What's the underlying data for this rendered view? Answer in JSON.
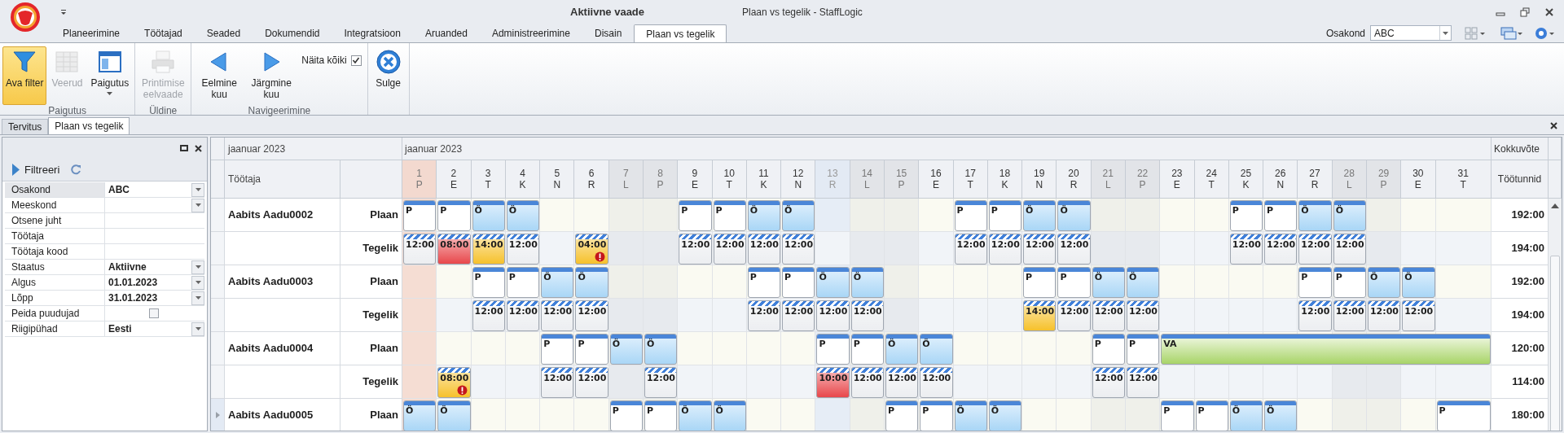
{
  "window": {
    "view_label": "Aktiivne vaade",
    "title": "Plaan vs tegelik - StaffLogic"
  },
  "ribbon_tabs": [
    {
      "label": "Planeerimine",
      "selected": false
    },
    {
      "label": "Töötajad",
      "selected": false
    },
    {
      "label": "Seaded",
      "selected": false
    },
    {
      "label": "Dokumendid",
      "selected": false
    },
    {
      "label": "Integratsioon",
      "selected": false
    },
    {
      "label": "Aruanded",
      "selected": false
    },
    {
      "label": "Administreerimine",
      "selected": false
    },
    {
      "label": "Disain",
      "selected": false
    },
    {
      "label": "Plaan vs tegelik",
      "selected": true
    }
  ],
  "department": {
    "label": "Osakond",
    "value": "ABC"
  },
  "ribbon_groups": [
    {
      "label": "Paigutus",
      "items": [
        {
          "kind": "filter",
          "label": "Ava filter",
          "pressed": true,
          "disabled": false,
          "dropdown": false
        },
        {
          "kind": "columns",
          "label": "Veerud",
          "pressed": false,
          "disabled": true,
          "dropdown": false
        },
        {
          "kind": "layout",
          "label": "Paigutus",
          "pressed": false,
          "disabled": false,
          "dropdown": true
        }
      ]
    },
    {
      "label": "Üldine",
      "items": [
        {
          "kind": "print",
          "label": "Printimise eelvaade",
          "pressed": false,
          "disabled": true,
          "dropdown": false
        }
      ]
    },
    {
      "label": "Navigeerimine",
      "items": [
        {
          "kind": "previous",
          "label": "Eelmine kuu",
          "pressed": false,
          "disabled": false,
          "dropdown": false
        },
        {
          "kind": "next",
          "label": "Järgmine kuu",
          "pressed": false,
          "disabled": false,
          "dropdown": false
        },
        {
          "kind": "checkbox",
          "label": "Näita kõiki",
          "checked": true
        }
      ]
    },
    {
      "items": [
        {
          "kind": "close",
          "label": "Sulge",
          "pressed": false,
          "disabled": false,
          "dropdown": false
        }
      ]
    }
  ],
  "document_tabs": [
    {
      "label": "Tervitus",
      "selected": false
    },
    {
      "label": "Plaan vs tegelik",
      "selected": true
    }
  ],
  "filter_panel": {
    "button": "Filtreeri",
    "fields": [
      {
        "label": "Osakond",
        "value": "ABC",
        "kind": "dropdown",
        "selected": true
      },
      {
        "label": "Meeskond",
        "kind": "dropdown",
        "selected": false
      },
      {
        "label": "Otsene juht",
        "kind": "text",
        "selected": false
      },
      {
        "label": "Töötaja",
        "kind": "text",
        "selected": false
      },
      {
        "label": "Töötaja kood",
        "kind": "text",
        "selected": false
      },
      {
        "label": "Staatus",
        "value": "Aktiivne",
        "kind": "dropdown",
        "selected": false
      },
      {
        "label": "Algus",
        "value": "01.01.2023",
        "kind": "dropdown",
        "selected": false
      },
      {
        "label": "Lõpp",
        "value": "31.01.2023",
        "kind": "dropdown",
        "selected": false
      },
      {
        "label": "Peida puudujad",
        "kind": "checkbox",
        "checked": false,
        "selected": false
      },
      {
        "label": "Riigipühad",
        "value": "Eesti",
        "kind": "dropdown",
        "selected": false
      }
    ]
  },
  "schedule": {
    "left_month": "jaanuar 2023",
    "month": "jaanuar 2023",
    "employee_header": "Töötaja",
    "summary_header": "Kokkuvõte",
    "hours_header": "Töötunnid",
    "days": [
      {
        "date": "1",
        "weekday": "P",
        "kind": "holiday"
      },
      {
        "date": "2",
        "weekday": "E",
        "kind": "weekday"
      },
      {
        "date": "3",
        "weekday": "T",
        "kind": "weekday"
      },
      {
        "date": "4",
        "weekday": "K",
        "kind": "weekday"
      },
      {
        "date": "5",
        "weekday": "N",
        "kind": "weekday"
      },
      {
        "date": "6",
        "weekday": "R",
        "kind": "weekday"
      },
      {
        "date": "7",
        "weekday": "L",
        "kind": "weekend"
      },
      {
        "date": "8",
        "weekday": "P",
        "kind": "weekend"
      },
      {
        "date": "9",
        "weekday": "E",
        "kind": "weekday"
      },
      {
        "date": "10",
        "weekday": "T",
        "kind": "weekday"
      },
      {
        "date": "11",
        "weekday": "K",
        "kind": "weekday"
      },
      {
        "date": "12",
        "weekday": "N",
        "kind": "weekday"
      },
      {
        "date": "13",
        "weekday": "R",
        "kind": "today"
      },
      {
        "date": "14",
        "weekday": "L",
        "kind": "weekend"
      },
      {
        "date": "15",
        "weekday": "P",
        "kind": "weekend"
      },
      {
        "date": "16",
        "weekday": "E",
        "kind": "weekday"
      },
      {
        "date": "17",
        "weekday": "T",
        "kind": "weekday"
      },
      {
        "date": "18",
        "weekday": "K",
        "kind": "weekday"
      },
      {
        "date": "19",
        "weekday": "N",
        "kind": "weekday"
      },
      {
        "date": "20",
        "weekday": "R",
        "kind": "weekday"
      },
      {
        "date": "21",
        "weekday": "L",
        "kind": "weekend"
      },
      {
        "date": "22",
        "weekday": "P",
        "kind": "weekend"
      },
      {
        "date": "23",
        "weekday": "E",
        "kind": "weekday"
      },
      {
        "date": "24",
        "weekday": "T",
        "kind": "weekday"
      },
      {
        "date": "25",
        "weekday": "K",
        "kind": "weekday"
      },
      {
        "date": "26",
        "weekday": "N",
        "kind": "weekday"
      },
      {
        "date": "27",
        "weekday": "R",
        "kind": "weekday"
      },
      {
        "date": "28",
        "weekday": "L",
        "kind": "weekend"
      },
      {
        "date": "29",
        "weekday": "P",
        "kind": "weekend"
      },
      {
        "date": "30",
        "weekday": "E",
        "kind": "weekday"
      },
      {
        "date": "31",
        "weekday": "T",
        "kind": "weekday"
      }
    ],
    "rows": [
      {
        "employee": "Aabits Aadu0002",
        "type": "Plaan",
        "kind": "plan",
        "total": "192:00",
        "selected": false,
        "cells": [
          {
            "kind": "p",
            "label": "P"
          },
          {
            "kind": "p",
            "label": "P"
          },
          {
            "kind": "o",
            "label": "Ö"
          },
          {
            "kind": "o",
            "label": "Ö"
          },
          {
            "kind": "none"
          },
          {
            "kind": "none"
          },
          {
            "kind": "none"
          },
          {
            "kind": "none"
          },
          {
            "kind": "p",
            "label": "P"
          },
          {
            "kind": "p",
            "label": "P"
          },
          {
            "kind": "o",
            "label": "Ö"
          },
          {
            "kind": "o",
            "label": "Ö"
          },
          {
            "kind": "none"
          },
          {
            "kind": "none"
          },
          {
            "kind": "none"
          },
          {
            "kind": "none"
          },
          {
            "kind": "p",
            "label": "P"
          },
          {
            "kind": "p",
            "label": "P"
          },
          {
            "kind": "o",
            "label": "Ö"
          },
          {
            "kind": "o",
            "label": "Ö"
          },
          {
            "kind": "none"
          },
          {
            "kind": "none"
          },
          {
            "kind": "none"
          },
          {
            "kind": "none"
          },
          {
            "kind": "p",
            "label": "P"
          },
          {
            "kind": "p",
            "label": "P"
          },
          {
            "kind": "o",
            "label": "Ö"
          },
          {
            "kind": "o",
            "label": "Ö"
          },
          {
            "kind": "none"
          },
          {
            "kind": "none"
          },
          {
            "kind": "none"
          }
        ]
      },
      {
        "type": "Tegelik",
        "kind": "actual",
        "total": "194:00",
        "selected": false,
        "cells": [
          {
            "kind": "actual",
            "label": "12:00",
            "color": "#eceef1",
            "alert": false
          },
          {
            "kind": "actual",
            "label": "08:00",
            "color": "#e8474b",
            "alert": false
          },
          {
            "kind": "actual",
            "label": "14:00",
            "color": "#f6c12b",
            "alert": false
          },
          {
            "kind": "actual",
            "label": "12:00",
            "color": "#eceef1",
            "alert": false
          },
          {
            "kind": "none"
          },
          {
            "kind": "actual",
            "label": "04:00",
            "color": "#f6c12b",
            "alert": true
          },
          {
            "kind": "none"
          },
          {
            "kind": "none"
          },
          {
            "kind": "actual",
            "label": "12:00",
            "color": "#eceef1",
            "alert": false
          },
          {
            "kind": "actual",
            "label": "12:00",
            "color": "#eceef1",
            "alert": false
          },
          {
            "kind": "actual",
            "label": "12:00",
            "color": "#eceef1",
            "alert": false
          },
          {
            "kind": "actual",
            "label": "12:00",
            "color": "#eceef1",
            "alert": false
          },
          {
            "kind": "none"
          },
          {
            "kind": "none"
          },
          {
            "kind": "none"
          },
          {
            "kind": "none"
          },
          {
            "kind": "actual",
            "label": "12:00",
            "color": "#eceef1",
            "alert": false
          },
          {
            "kind": "actual",
            "label": "12:00",
            "color": "#eceef1",
            "alert": false
          },
          {
            "kind": "actual",
            "label": "12:00",
            "color": "#eceef1",
            "alert": false
          },
          {
            "kind": "actual",
            "label": "12:00",
            "color": "#eceef1",
            "alert": false
          },
          {
            "kind": "none"
          },
          {
            "kind": "none"
          },
          {
            "kind": "none"
          },
          {
            "kind": "none"
          },
          {
            "kind": "actual",
            "label": "12:00",
            "color": "#eceef1",
            "alert": false
          },
          {
            "kind": "actual",
            "label": "12:00",
            "color": "#eceef1",
            "alert": false
          },
          {
            "kind": "actual",
            "label": "12:00",
            "color": "#eceef1",
            "alert": false
          },
          {
            "kind": "actual",
            "label": "12:00",
            "color": "#eceef1",
            "alert": false
          },
          {
            "kind": "none"
          },
          {
            "kind": "none"
          },
          {
            "kind": "none"
          }
        ]
      },
      {
        "employee": "Aabits Aadu0003",
        "type": "Plaan",
        "kind": "plan",
        "total": "192:00",
        "selected": false,
        "cells": [
          {
            "kind": "none"
          },
          {
            "kind": "none"
          },
          {
            "kind": "p",
            "label": "P"
          },
          {
            "kind": "p",
            "label": "P"
          },
          {
            "kind": "o",
            "label": "Ö"
          },
          {
            "kind": "o",
            "label": "Ö"
          },
          {
            "kind": "none"
          },
          {
            "kind": "none"
          },
          {
            "kind": "none"
          },
          {
            "kind": "none"
          },
          {
            "kind": "p",
            "label": "P"
          },
          {
            "kind": "p",
            "label": "P"
          },
          {
            "kind": "o",
            "label": "Ö"
          },
          {
            "kind": "o",
            "label": "Ö"
          },
          {
            "kind": "none"
          },
          {
            "kind": "none"
          },
          {
            "kind": "none"
          },
          {
            "kind": "none"
          },
          {
            "kind": "p",
            "label": "P"
          },
          {
            "kind": "p",
            "label": "P"
          },
          {
            "kind": "o",
            "label": "Ö"
          },
          {
            "kind": "o",
            "label": "Ö"
          },
          {
            "kind": "none"
          },
          {
            "kind": "none"
          },
          {
            "kind": "none"
          },
          {
            "kind": "none"
          },
          {
            "kind": "p",
            "label": "P"
          },
          {
            "kind": "p",
            "label": "P"
          },
          {
            "kind": "o",
            "label": "Ö"
          },
          {
            "kind": "o",
            "label": "Ö"
          },
          {
            "kind": "none"
          }
        ]
      },
      {
        "type": "Tegelik",
        "kind": "actual",
        "total": "194:00",
        "selected": false,
        "cells": [
          {
            "kind": "none"
          },
          {
            "kind": "none"
          },
          {
            "kind": "actual",
            "label": "12:00",
            "color": "#eceef1",
            "alert": false
          },
          {
            "kind": "actual",
            "label": "12:00",
            "color": "#eceef1",
            "alert": false
          },
          {
            "kind": "actual",
            "label": "12:00",
            "color": "#eceef1",
            "alert": false
          },
          {
            "kind": "actual",
            "label": "12:00",
            "color": "#eceef1",
            "alert": false
          },
          {
            "kind": "none"
          },
          {
            "kind": "none"
          },
          {
            "kind": "none"
          },
          {
            "kind": "none"
          },
          {
            "kind": "actual",
            "label": "12:00",
            "color": "#eceef1",
            "alert": false
          },
          {
            "kind": "actual",
            "label": "12:00",
            "color": "#eceef1",
            "alert": false
          },
          {
            "kind": "actual",
            "label": "12:00",
            "color": "#eceef1",
            "alert": false
          },
          {
            "kind": "actual",
            "label": "12:00",
            "color": "#eceef1",
            "alert": false
          },
          {
            "kind": "none"
          },
          {
            "kind": "none"
          },
          {
            "kind": "none"
          },
          {
            "kind": "none"
          },
          {
            "kind": "actual",
            "label": "14:00",
            "color": "#f6c12b",
            "alert": false
          },
          {
            "kind": "actual",
            "label": "12:00",
            "color": "#eceef1",
            "alert": false
          },
          {
            "kind": "actual",
            "label": "12:00",
            "color": "#eceef1",
            "alert": false
          },
          {
            "kind": "actual",
            "label": "12:00",
            "color": "#eceef1",
            "alert": false
          },
          {
            "kind": "none"
          },
          {
            "kind": "none"
          },
          {
            "kind": "none"
          },
          {
            "kind": "none"
          },
          {
            "kind": "actual",
            "label": "12:00",
            "color": "#eceef1",
            "alert": false
          },
          {
            "kind": "actual",
            "label": "12:00",
            "color": "#eceef1",
            "alert": false
          },
          {
            "kind": "actual",
            "label": "12:00",
            "color": "#eceef1",
            "alert": false
          },
          {
            "kind": "actual",
            "label": "12:00",
            "color": "#eceef1",
            "alert": false
          },
          {
            "kind": "none"
          }
        ]
      },
      {
        "employee": "Aabits Aadu0004",
        "type": "Plaan",
        "kind": "plan",
        "total": "120:00",
        "selected": false,
        "cells": [
          {
            "kind": "none"
          },
          {
            "kind": "none"
          },
          {
            "kind": "none"
          },
          {
            "kind": "none"
          },
          {
            "kind": "p",
            "label": "P"
          },
          {
            "kind": "p",
            "label": "P"
          },
          {
            "kind": "o",
            "label": "Ö"
          },
          {
            "kind": "o",
            "label": "Ö"
          },
          {
            "kind": "none"
          },
          {
            "kind": "none"
          },
          {
            "kind": "none"
          },
          {
            "kind": "none"
          },
          {
            "kind": "p",
            "label": "P"
          },
          {
            "kind": "p",
            "label": "P"
          },
          {
            "kind": "o",
            "label": "Ö"
          },
          {
            "kind": "o",
            "label": "Ö"
          },
          {
            "kind": "none"
          },
          {
            "kind": "none"
          },
          {
            "kind": "none"
          },
          {
            "kind": "none"
          },
          {
            "kind": "p",
            "label": "P"
          },
          {
            "kind": "p",
            "label": "P"
          },
          {
            "kind": "vacation",
            "label": "VA"
          },
          {
            "kind": "continued"
          },
          {
            "kind": "continued"
          },
          {
            "kind": "continued"
          },
          {
            "kind": "continued"
          },
          {
            "kind": "continued"
          },
          {
            "kind": "continued"
          },
          {
            "kind": "continued"
          },
          {
            "kind": "continued"
          }
        ]
      },
      {
        "type": "Tegelik",
        "kind": "actual",
        "total": "114:00",
        "selected": false,
        "cells": [
          {
            "kind": "none"
          },
          {
            "kind": "actual",
            "label": "08:00",
            "color": "#f6c12b",
            "alert": true
          },
          {
            "kind": "none"
          },
          {
            "kind": "none"
          },
          {
            "kind": "actual",
            "label": "12:00",
            "color": "#eceef1",
            "alert": false
          },
          {
            "kind": "actual",
            "label": "12:00",
            "color": "#eceef1",
            "alert": false
          },
          {
            "kind": "none"
          },
          {
            "kind": "actual",
            "label": "12:00",
            "color": "#eceef1",
            "alert": false
          },
          {
            "kind": "none"
          },
          {
            "kind": "none"
          },
          {
            "kind": "none"
          },
          {
            "kind": "none"
          },
          {
            "kind": "actual",
            "label": "10:00",
            "color": "#e8474b",
            "alert": false
          },
          {
            "kind": "actual",
            "label": "12:00",
            "color": "#eceef1",
            "alert": false
          },
          {
            "kind": "actual",
            "label": "12:00",
            "color": "#eceef1",
            "alert": false
          },
          {
            "kind": "actual",
            "label": "12:00",
            "color": "#eceef1",
            "alert": false
          },
          {
            "kind": "none"
          },
          {
            "kind": "none"
          },
          {
            "kind": "none"
          },
          {
            "kind": "none"
          },
          {
            "kind": "actual",
            "label": "12:00",
            "color": "#eceef1",
            "alert": false
          },
          {
            "kind": "actual",
            "label": "12:00",
            "color": "#eceef1",
            "alert": false
          },
          {
            "kind": "none"
          },
          {
            "kind": "none"
          },
          {
            "kind": "none"
          },
          {
            "kind": "none"
          },
          {
            "kind": "none"
          },
          {
            "kind": "none"
          },
          {
            "kind": "none"
          },
          {
            "kind": "none"
          },
          {
            "kind": "none"
          }
        ]
      },
      {
        "employee": "Aabits Aadu0005",
        "type": "Plaan",
        "kind": "plan",
        "total": "180:00",
        "selected": true,
        "cells": [
          {
            "kind": "o",
            "label": "Ö"
          },
          {
            "kind": "o",
            "label": "Ö"
          },
          {
            "kind": "none"
          },
          {
            "kind": "none"
          },
          {
            "kind": "none"
          },
          {
            "kind": "none"
          },
          {
            "kind": "p",
            "label": "P"
          },
          {
            "kind": "p",
            "label": "P"
          },
          {
            "kind": "o",
            "label": "Ö"
          },
          {
            "kind": "o",
            "label": "Ö"
          },
          {
            "kind": "none"
          },
          {
            "kind": "none"
          },
          {
            "kind": "none"
          },
          {
            "kind": "none"
          },
          {
            "kind": "p",
            "label": "P"
          },
          {
            "kind": "p",
            "label": "P"
          },
          {
            "kind": "o",
            "label": "Ö"
          },
          {
            "kind": "o",
            "label": "Ö"
          },
          {
            "kind": "none"
          },
          {
            "kind": "none"
          },
          {
            "kind": "none"
          },
          {
            "kind": "none"
          },
          {
            "kind": "p",
            "label": "P"
          },
          {
            "kind": "p",
            "label": "P"
          },
          {
            "kind": "o",
            "label": "Ö"
          },
          {
            "kind": "o",
            "label": "Ö"
          },
          {
            "kind": "none"
          },
          {
            "kind": "none"
          },
          {
            "kind": "none"
          },
          {
            "kind": "none"
          },
          {
            "kind": "p",
            "label": "P"
          }
        ]
      }
    ]
  }
}
